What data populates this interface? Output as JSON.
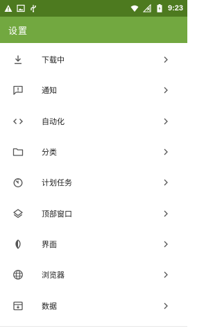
{
  "status_bar": {
    "time": "9:23",
    "left_icons": [
      "warning-icon",
      "image-icon",
      "usb-icon"
    ],
    "right_icons": [
      "wifi-icon",
      "no-signal-icon",
      "battery-icon"
    ]
  },
  "app_bar": {
    "title": "设置"
  },
  "menu": {
    "items": [
      {
        "label": "下载中",
        "icon": "download-icon"
      },
      {
        "label": "通知",
        "icon": "notification-icon"
      },
      {
        "label": "自动化",
        "icon": "code-icon"
      },
      {
        "label": "分类",
        "icon": "folder-icon"
      },
      {
        "label": "计划任务",
        "icon": "timer-icon"
      },
      {
        "label": "顶部窗口",
        "icon": "layers-icon"
      },
      {
        "label": "界面",
        "icon": "contrast-icon"
      },
      {
        "label": "浏览器",
        "icon": "globe-icon"
      },
      {
        "label": "数据",
        "icon": "archive-icon"
      }
    ]
  },
  "colors": {
    "status_bar": "#4d7a1f",
    "app_bar": "#72a840",
    "icon": "#555555",
    "text": "#222222"
  }
}
